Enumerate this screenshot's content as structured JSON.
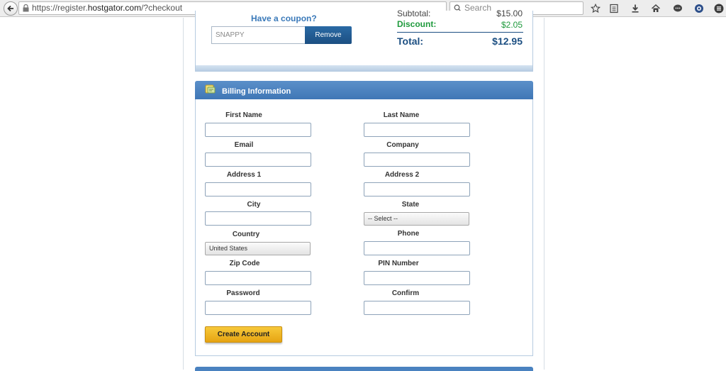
{
  "browser": {
    "url_prefix": "https://register.",
    "url_host": "hostgator.com",
    "url_path": "/?checkout",
    "search_placeholder": "Search"
  },
  "summary": {
    "coupon_heading": "Have a coupon?",
    "coupon_value": "SNAPPY",
    "remove_label": "Remove",
    "subtotal_label": "Subtotal:",
    "subtotal_value": "$15.00",
    "discount_label": "Discount:",
    "discount_value": "$2.05",
    "total_label": "Total:",
    "total_value": "$12.95"
  },
  "billing": {
    "title": "Billing Information",
    "fields": {
      "first_name": "First Name",
      "last_name": "Last Name",
      "email": "Email",
      "company": "Company",
      "address1": "Address 1",
      "address2": "Address 2",
      "city": "City",
      "state": "State",
      "country": "Country",
      "phone": "Phone",
      "zip": "Zip Code",
      "pin": "PIN Number",
      "password": "Password",
      "confirm": "Confirm"
    },
    "state_selected": "-- Select --",
    "country_selected": "United States",
    "create_label": "Create Account"
  },
  "colors": {
    "header_blue": "#3f77b6",
    "button_gold": "#f2b928",
    "discount_green": "#1e9a3c",
    "total_navy": "#1c4f82"
  }
}
